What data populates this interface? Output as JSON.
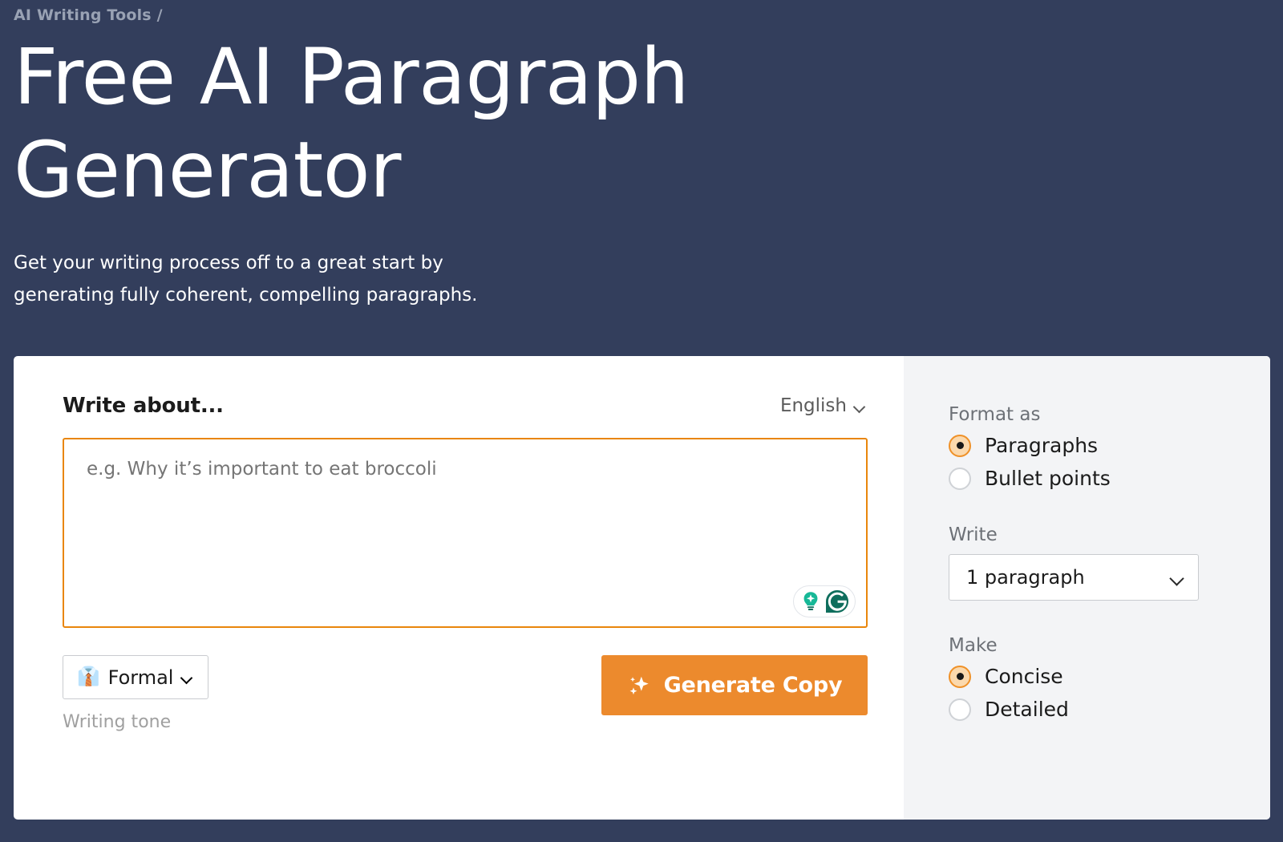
{
  "hero": {
    "breadcrumb": "AI Writing Tools /",
    "title": "Free AI Paragraph Generator",
    "subtitle": "Get your writing process off to a great start by generating fully coherent, compelling paragraphs."
  },
  "editor": {
    "section_title": "Write about...",
    "language": "English",
    "placeholder": "e.g. Why it’s important to eat broccoli",
    "input_value": "",
    "grammarly_badge": {
      "bulb_icon": "lightbulb-icon",
      "brand_icon": "grammarly-logo-icon"
    },
    "tone": {
      "emoji": "👔",
      "value": "Formal",
      "helper": "Writing tone"
    },
    "generate_button": {
      "label": "Generate Copy",
      "icon": "sparkles-icon"
    }
  },
  "sidebar": {
    "format": {
      "label": "Format as",
      "options": [
        {
          "label": "Paragraphs",
          "selected": true
        },
        {
          "label": "Bullet points",
          "selected": false
        }
      ]
    },
    "write": {
      "label": "Write",
      "value": "1 paragraph"
    },
    "make": {
      "label": "Make",
      "options": [
        {
          "label": "Concise",
          "selected": true
        },
        {
          "label": "Detailed",
          "selected": false
        }
      ]
    }
  },
  "colors": {
    "page_background": "#333e5c",
    "accent_orange": "#ec8a2d",
    "input_border": "#e9860c",
    "sidebar_background": "#f3f4f6",
    "grammarly_green": "#15c39a",
    "grammarly_dark": "#0f6e5d"
  }
}
